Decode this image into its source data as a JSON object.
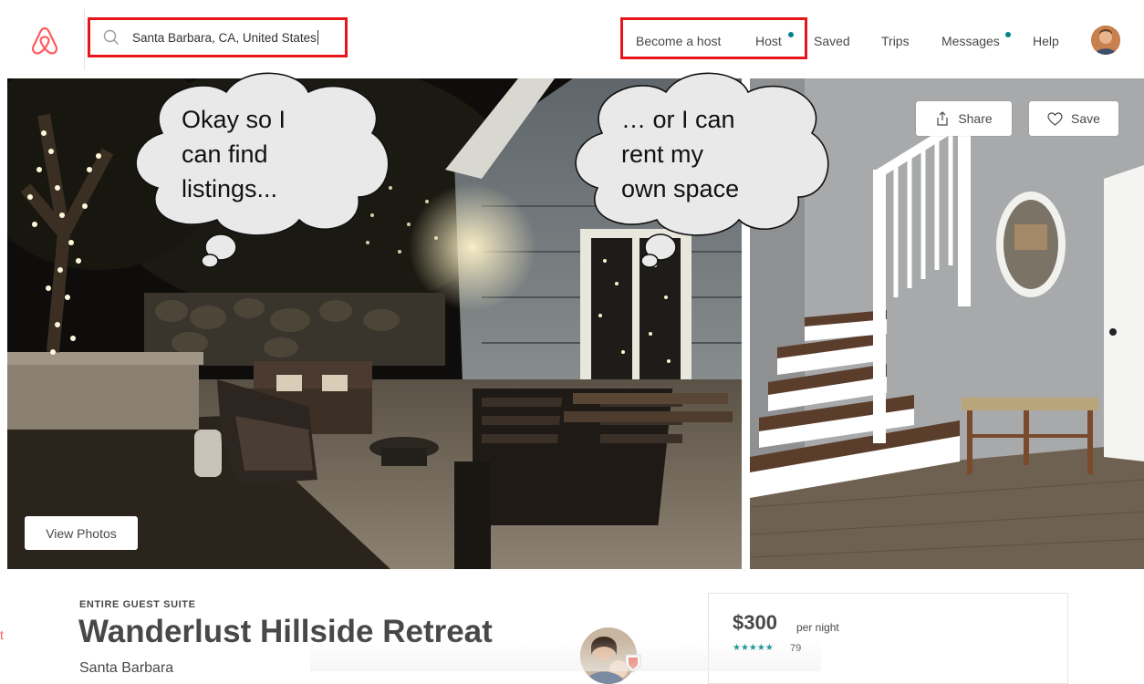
{
  "header": {
    "logo_icon": "airbnb-logo-icon",
    "search": {
      "value": "Santa Barbara, CA, United States",
      "icon": "search-icon"
    },
    "nav": {
      "become_host": "Become a host",
      "host": "Host",
      "saved": "Saved",
      "trips": "Trips",
      "messages": "Messages",
      "help": "Help"
    },
    "notification_dot_color": "#008489",
    "highlight_color": "#e8161b"
  },
  "gallery": {
    "view_photos": "View Photos",
    "share": "Share",
    "save": "Save"
  },
  "annotations": {
    "left_bubble": [
      "Okay so I",
      "can find",
      "listings..."
    ],
    "right_bubble": [
      "… or I can",
      "rent my",
      "own space"
    ]
  },
  "listing": {
    "type": "ENTIRE GUEST SUITE",
    "title": "Wanderlust Hillside Retreat",
    "city": "Santa Barbara"
  },
  "booking": {
    "price": "$300",
    "per_night": "per night",
    "stars": "★★★★★",
    "rating": 5,
    "review_count": "79"
  }
}
